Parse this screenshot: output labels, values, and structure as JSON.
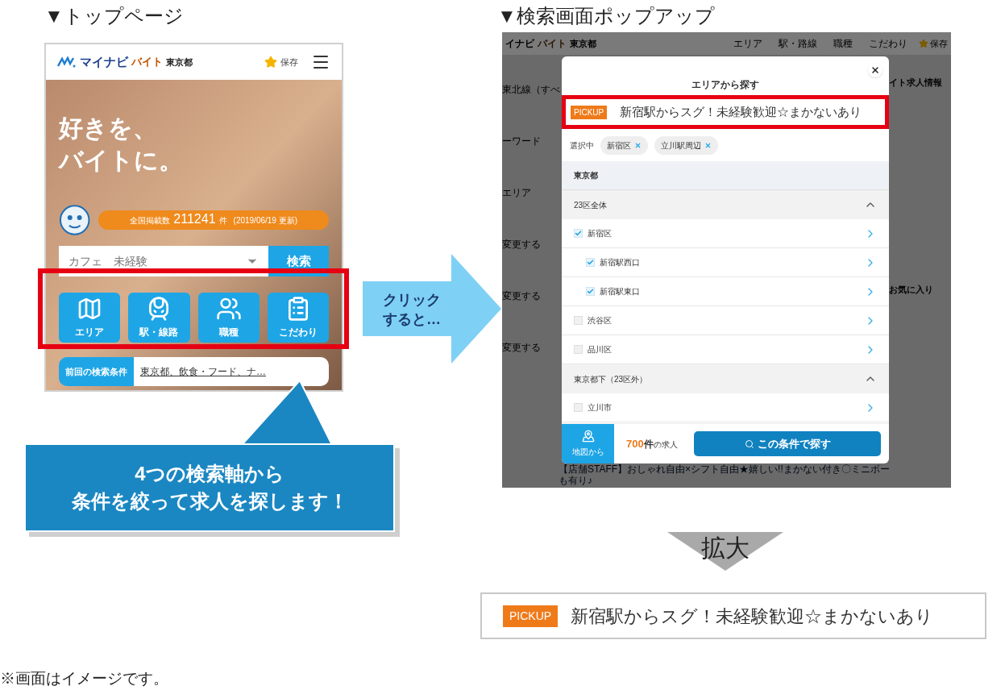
{
  "left_panel": {
    "title": "▼トップページ",
    "phone": {
      "logo": "マイナビ",
      "logo_sub": "バイト",
      "region": "東京都",
      "save": "保存",
      "headline": [
        "好きを、",
        "バイトに。"
      ],
      "count_label": "全国掲載数",
      "count": "211241",
      "count_unit": "件",
      "count_date": "(2019/06/19 更新)",
      "search_value": "カフェ　未経験",
      "search_button": "検索",
      "categories": [
        {
          "label": "エリア",
          "kind": "map"
        },
        {
          "label": "駅・線路",
          "kind": "train"
        },
        {
          "label": "職種",
          "kind": "staff"
        },
        {
          "label": "こだわり",
          "kind": "checklist"
        }
      ],
      "previous_label": "前回の検索条件",
      "previous_value": "東京都、飲食・フード、ナ…"
    },
    "callout": [
      "4つの検索軸から",
      "条件を絞って求人を探します！"
    ]
  },
  "arrow": [
    "クリック",
    "すると…"
  ],
  "right_panel": {
    "title": "▼検索画面ポップアップ",
    "background": {
      "logo": "イナビ",
      "logo_sub": "バイト",
      "region": "東京都",
      "nav": [
        "エリア",
        "駅・路線",
        "職種",
        "こだわり"
      ],
      "save": "保存",
      "left_texts": [
        "東北線（すべ",
        "ーワード",
        "エリア",
        "変更する",
        "変更する",
        "変更する"
      ],
      "right_texts": [
        "イト求人情報",
        "お気に入り"
      ],
      "job_title": [
        "【店舗STAFF】おしゃれ自由×シフト自由★嬉しい!!まかない付き〇ミニボー",
        "も有り♪"
      ]
    },
    "modal": {
      "title": "エリアから探す",
      "pickup": {
        "badge": "PICKUP",
        "text": "新宿駅からスグ！未経験歓迎☆まかないあり"
      },
      "selected_label": "選択中",
      "chips": [
        {
          "label": "新宿区"
        },
        {
          "label": "立川駅周辺"
        }
      ],
      "rows": [
        {
          "kind": "region",
          "label": "東京都"
        },
        {
          "kind": "group",
          "label": "23区全体",
          "expanded": true
        },
        {
          "kind": "item",
          "label": "新宿区",
          "checked": true,
          "children": [
            {
              "label": "新宿駅西口",
              "checked": true
            },
            {
              "label": "新宿駅東口",
              "checked": true
            }
          ]
        },
        {
          "kind": "item",
          "label": "渋谷区",
          "checked": false
        },
        {
          "kind": "item",
          "label": "品川区",
          "checked": false
        },
        {
          "kind": "group",
          "label": "東京都下（23区外）",
          "expanded": true
        },
        {
          "kind": "item",
          "label": "立川市",
          "checked": false
        }
      ],
      "footer": {
        "map_label": "地図から",
        "count": "700",
        "count_unit": "件",
        "count_suffix": "の求人",
        "search_button": "この条件で探す"
      }
    }
  },
  "zoom": {
    "label": "拡大",
    "pickup": {
      "badge": "PICKUP",
      "text": "新宿駅からスグ！未経験歓迎☆まかないあり"
    }
  },
  "footnote": "※画面はイメージです。"
}
